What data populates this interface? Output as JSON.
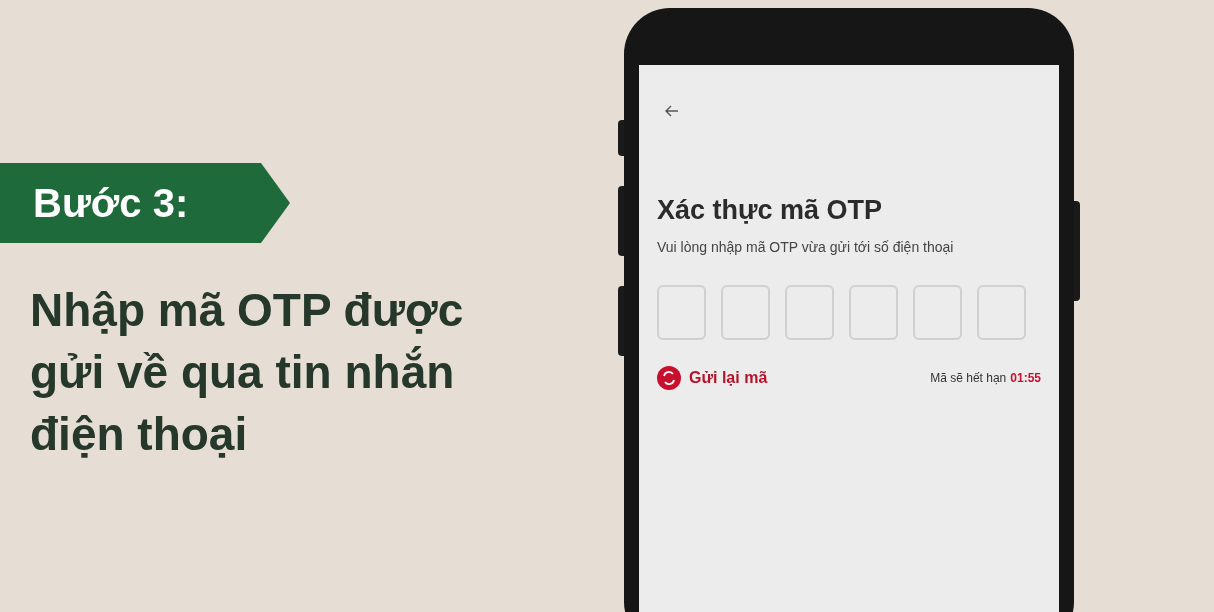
{
  "step_banner": {
    "label": "Bước 3:"
  },
  "instruction": "Nhập mã OTP được gửi về qua tin nhắn điện thoại",
  "phone_screen": {
    "title": "Xác thực mã OTP",
    "subtitle": "Vui lòng nhập mã OTP vừa gửi tới số điện thoại",
    "otp_fields": [
      {
        "filled": false
      },
      {
        "filled": false
      },
      {
        "filled": false
      },
      {
        "filled": false
      },
      {
        "filled": false
      },
      {
        "filled": false
      }
    ],
    "resend_link": "Gửi lại mã",
    "expiry_label": "Mã sẽ hết hạn",
    "expiry_time": "01:55"
  }
}
